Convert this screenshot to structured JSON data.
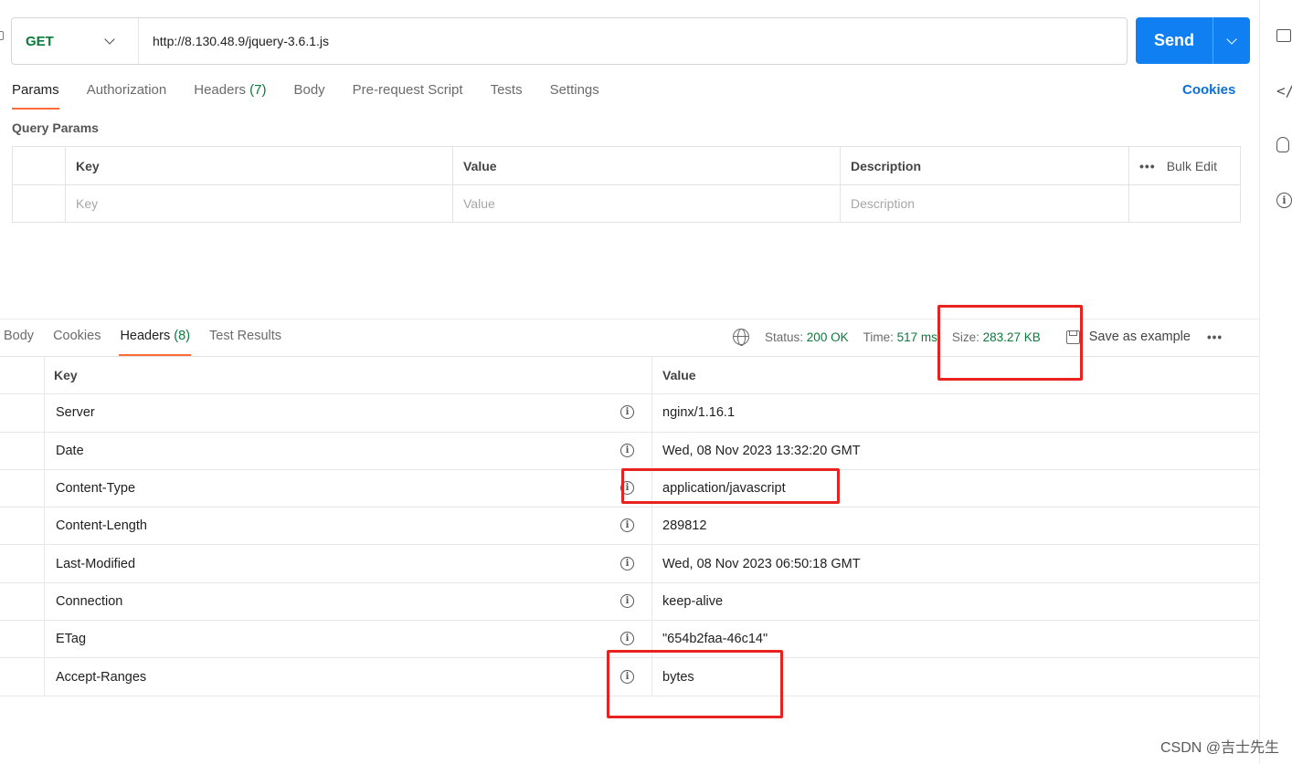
{
  "request": {
    "method": "GET",
    "url": "http://8.130.48.9/jquery-3.6.1.js",
    "send_label": "Send"
  },
  "request_tabs": [
    {
      "label": "Params",
      "active": true
    },
    {
      "label": "Authorization"
    },
    {
      "label": "Headers",
      "count": "(7)"
    },
    {
      "label": "Body"
    },
    {
      "label": "Pre-request Script"
    },
    {
      "label": "Tests"
    },
    {
      "label": "Settings"
    }
  ],
  "cookies_link": "Cookies",
  "query_params": {
    "title": "Query Params",
    "headers": {
      "key": "Key",
      "value": "Value",
      "description": "Description",
      "bulk_edit": "Bulk Edit"
    },
    "placeholders": {
      "key": "Key",
      "value": "Value",
      "description": "Description"
    }
  },
  "response_tabs": [
    {
      "label": "Body"
    },
    {
      "label": "Cookies"
    },
    {
      "label": "Headers",
      "count": "(8)",
      "active": true
    },
    {
      "label": "Test Results"
    }
  ],
  "response_status": {
    "status_label": "Status:",
    "status_value": "200 OK",
    "time_label": "Time:",
    "time_value": "517 ms",
    "size_label": "Size:",
    "size_value": "283.27 KB",
    "save_example": "Save as example"
  },
  "response_headers": {
    "columns": {
      "key": "Key",
      "value": "Value"
    },
    "rows": [
      {
        "key": "Server",
        "value": "nginx/1.16.1"
      },
      {
        "key": "Date",
        "value": "Wed, 08 Nov 2023 13:32:20 GMT"
      },
      {
        "key": "Content-Type",
        "value": "application/javascript"
      },
      {
        "key": "Content-Length",
        "value": "289812"
      },
      {
        "key": "Last-Modified",
        "value": "Wed, 08 Nov 2023 06:50:18 GMT"
      },
      {
        "key": "Connection",
        "value": "keep-alive"
      },
      {
        "key": "ETag",
        "value": "\"654b2faa-46c14\""
      },
      {
        "key": "Accept-Ranges",
        "value": "bytes"
      }
    ]
  },
  "icons": {
    "right_rail": [
      "comment-icon",
      "code-icon",
      "lightbulb-icon",
      "info-icon"
    ],
    "info_header": "info-icon",
    "globe": "globe-icon",
    "save": "save-icon"
  },
  "colors": {
    "send_button": "#0f7ff2",
    "active_tab_underline": "#ff6c37",
    "method_green": "#0a7a3b",
    "annotation_red": "#e8231f",
    "cookies_link": "#0b6fd6"
  },
  "watermark": "CSDN @吉士先生"
}
